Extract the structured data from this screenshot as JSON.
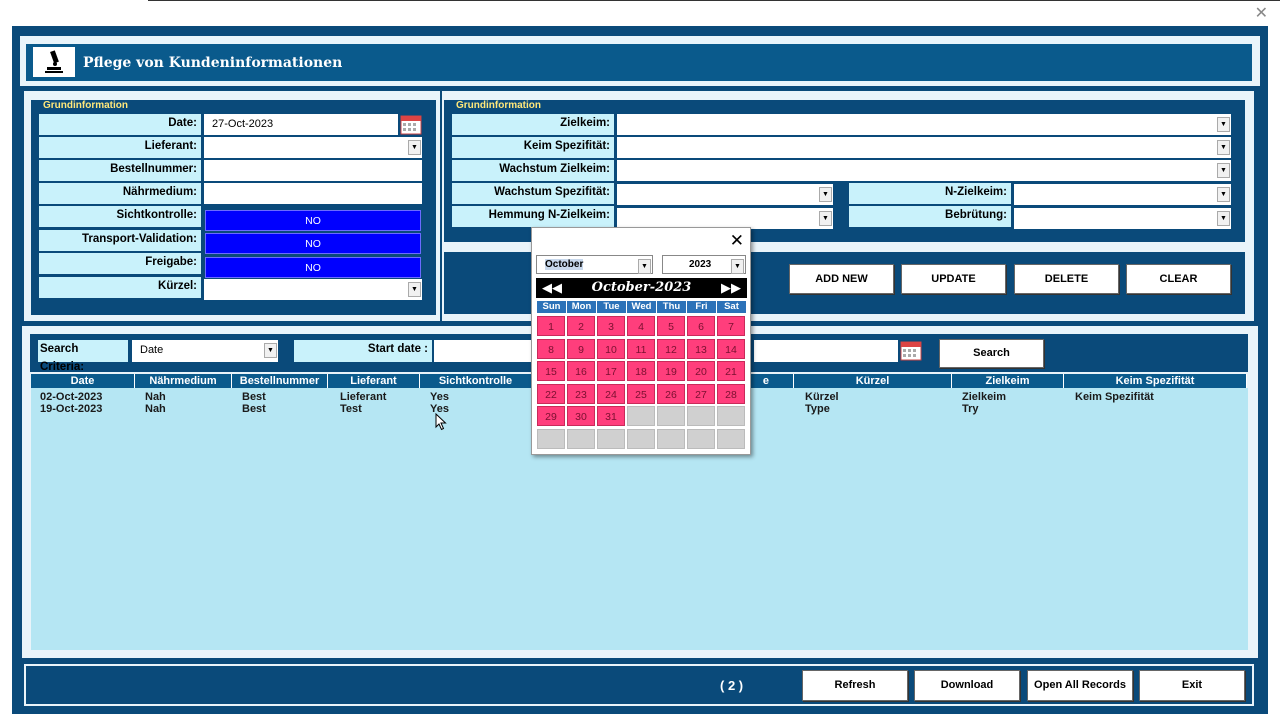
{
  "app": {
    "title": "Pflege von Kundeninformationen"
  },
  "left_panel": {
    "legend": "Grundinformation",
    "date_label": "Date:",
    "date_value": "27-Oct-2023",
    "lieferant_label": "Lieferant:",
    "bestellnummer_label": "Bestellnummer:",
    "naehrmedium_label": "Nährmedium:",
    "sichtkontrolle_label": "Sichtkontrolle:",
    "sichtkontrolle_value": "NO",
    "transport_label": "Transport-Validation:",
    "transport_value": "NO",
    "freigabe_label": "Freigabe:",
    "freigabe_value": "NO",
    "kuerzel_label": "Kürzel:"
  },
  "right_panel": {
    "legend": "Grundinformation",
    "zielkeim_label": "Zielkeim:",
    "keim_spezifitaet_label": "Keim Spezifität:",
    "wachstum_zielkeim_label": "Wachstum Zielkeim:",
    "wachstum_spezifitaet_label": "Wachstum Spezifität:",
    "hemmung_label": "Hemmung N-Zielkeim:",
    "n_zielkeim_label": "N-Zielkeim:",
    "bebruetung_label": "Bebrütung:"
  },
  "actions": {
    "add_new": "ADD NEW",
    "update": "UPDATE",
    "delete": "DELETE",
    "clear": "CLEAR"
  },
  "search": {
    "criteria_label": "Search Criteria:",
    "criteria_value": "Date",
    "start_date_label": "Start date :",
    "search_button": "Search"
  },
  "table": {
    "headers": [
      "Date",
      "Nährmedium",
      "Bestellnummer",
      "Lieferant",
      "Sichtkontrolle",
      "e",
      "Kürzel",
      "Zielkeim",
      "Keim Spezifität"
    ],
    "rows": [
      {
        "date": "02-Oct-2023",
        "naehrmedium": "Nah",
        "bestellnummer": "Best",
        "lieferant": "Lieferant",
        "sichtkontrolle": "Yes",
        "kuerzel": "Kürzel",
        "zielkeim": "Zielkeim",
        "keim_spezifitaet": "Keim Spezifität"
      },
      {
        "date": "19-Oct-2023",
        "naehrmedium": "Nah",
        "bestellnummer": "Best",
        "lieferant": "Test",
        "sichtkontrolle": "Yes",
        "kuerzel": "Type",
        "zielkeim": "Try",
        "keim_spezifitaet": ""
      }
    ]
  },
  "calendar": {
    "month_select": "October",
    "year_select": "2023",
    "title": "October-2023",
    "prev": "◀◀",
    "next": "▶▶",
    "weekdays": [
      "Sun",
      "Mon",
      "Tue",
      "Wed",
      "Thu",
      "Fri",
      "Sat"
    ],
    "days": [
      "1",
      "2",
      "3",
      "4",
      "5",
      "6",
      "7",
      "8",
      "9",
      "10",
      "11",
      "12",
      "13",
      "14",
      "15",
      "16",
      "17",
      "18",
      "19",
      "20",
      "21",
      "22",
      "23",
      "24",
      "25",
      "26",
      "27",
      "28",
      "29",
      "30",
      "31"
    ]
  },
  "footer": {
    "record_count": "( 2 )",
    "refresh": "Refresh",
    "download": "Download",
    "open_all": "Open All Records",
    "exit": "Exit"
  }
}
